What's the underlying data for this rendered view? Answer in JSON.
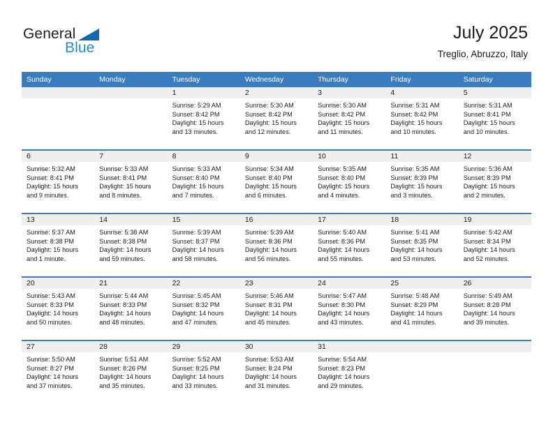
{
  "logo": {
    "word1": "General",
    "word2": "Blue",
    "triangle_color": "#1268b3",
    "word1_color": "#231f20",
    "word2_color": "#1b8fd4"
  },
  "header": {
    "title": "July 2025",
    "subtitle": "Treglio, Abruzzo, Italy"
  },
  "theme": {
    "header_blue": "#3a7cc0",
    "daynum_band": "#efefef",
    "text": "#1a1a1a"
  },
  "weekday_headers": [
    "Sunday",
    "Monday",
    "Tuesday",
    "Wednesday",
    "Thursday",
    "Friday",
    "Saturday"
  ],
  "labels": {
    "sunrise": "Sunrise:",
    "sunset": "Sunset:",
    "daylight": "Daylight:"
  },
  "weeks": [
    [
      {
        "day": "",
        "empty": true
      },
      {
        "day": "",
        "empty": true
      },
      {
        "day": "1",
        "sunrise": "Sunrise: 5:29 AM",
        "sunset": "Sunset: 8:42 PM",
        "daylight": "Daylight: 15 hours and 13 minutes."
      },
      {
        "day": "2",
        "sunrise": "Sunrise: 5:30 AM",
        "sunset": "Sunset: 8:42 PM",
        "daylight": "Daylight: 15 hours and 12 minutes."
      },
      {
        "day": "3",
        "sunrise": "Sunrise: 5:30 AM",
        "sunset": "Sunset: 8:42 PM",
        "daylight": "Daylight: 15 hours and 11 minutes."
      },
      {
        "day": "4",
        "sunrise": "Sunrise: 5:31 AM",
        "sunset": "Sunset: 8:42 PM",
        "daylight": "Daylight: 15 hours and 10 minutes."
      },
      {
        "day": "5",
        "sunrise": "Sunrise: 5:31 AM",
        "sunset": "Sunset: 8:41 PM",
        "daylight": "Daylight: 15 hours and 10 minutes."
      }
    ],
    [
      {
        "day": "6",
        "sunrise": "Sunrise: 5:32 AM",
        "sunset": "Sunset: 8:41 PM",
        "daylight": "Daylight: 15 hours and 9 minutes."
      },
      {
        "day": "7",
        "sunrise": "Sunrise: 5:33 AM",
        "sunset": "Sunset: 8:41 PM",
        "daylight": "Daylight: 15 hours and 8 minutes."
      },
      {
        "day": "8",
        "sunrise": "Sunrise: 5:33 AM",
        "sunset": "Sunset: 8:40 PM",
        "daylight": "Daylight: 15 hours and 7 minutes."
      },
      {
        "day": "9",
        "sunrise": "Sunrise: 5:34 AM",
        "sunset": "Sunset: 8:40 PM",
        "daylight": "Daylight: 15 hours and 6 minutes."
      },
      {
        "day": "10",
        "sunrise": "Sunrise: 5:35 AM",
        "sunset": "Sunset: 8:40 PM",
        "daylight": "Daylight: 15 hours and 4 minutes."
      },
      {
        "day": "11",
        "sunrise": "Sunrise: 5:35 AM",
        "sunset": "Sunset: 8:39 PM",
        "daylight": "Daylight: 15 hours and 3 minutes."
      },
      {
        "day": "12",
        "sunrise": "Sunrise: 5:36 AM",
        "sunset": "Sunset: 8:39 PM",
        "daylight": "Daylight: 15 hours and 2 minutes."
      }
    ],
    [
      {
        "day": "13",
        "sunrise": "Sunrise: 5:37 AM",
        "sunset": "Sunset: 8:38 PM",
        "daylight": "Daylight: 15 hours and 1 minute."
      },
      {
        "day": "14",
        "sunrise": "Sunrise: 5:38 AM",
        "sunset": "Sunset: 8:38 PM",
        "daylight": "Daylight: 14 hours and 59 minutes."
      },
      {
        "day": "15",
        "sunrise": "Sunrise: 5:39 AM",
        "sunset": "Sunset: 8:37 PM",
        "daylight": "Daylight: 14 hours and 58 minutes."
      },
      {
        "day": "16",
        "sunrise": "Sunrise: 5:39 AM",
        "sunset": "Sunset: 8:36 PM",
        "daylight": "Daylight: 14 hours and 56 minutes."
      },
      {
        "day": "17",
        "sunrise": "Sunrise: 5:40 AM",
        "sunset": "Sunset: 8:36 PM",
        "daylight": "Daylight: 14 hours and 55 minutes."
      },
      {
        "day": "18",
        "sunrise": "Sunrise: 5:41 AM",
        "sunset": "Sunset: 8:35 PM",
        "daylight": "Daylight: 14 hours and 53 minutes."
      },
      {
        "day": "19",
        "sunrise": "Sunrise: 5:42 AM",
        "sunset": "Sunset: 8:34 PM",
        "daylight": "Daylight: 14 hours and 52 minutes."
      }
    ],
    [
      {
        "day": "20",
        "sunrise": "Sunrise: 5:43 AM",
        "sunset": "Sunset: 8:33 PM",
        "daylight": "Daylight: 14 hours and 50 minutes."
      },
      {
        "day": "21",
        "sunrise": "Sunrise: 5:44 AM",
        "sunset": "Sunset: 8:33 PM",
        "daylight": "Daylight: 14 hours and 48 minutes."
      },
      {
        "day": "22",
        "sunrise": "Sunrise: 5:45 AM",
        "sunset": "Sunset: 8:32 PM",
        "daylight": "Daylight: 14 hours and 47 minutes."
      },
      {
        "day": "23",
        "sunrise": "Sunrise: 5:46 AM",
        "sunset": "Sunset: 8:31 PM",
        "daylight": "Daylight: 14 hours and 45 minutes."
      },
      {
        "day": "24",
        "sunrise": "Sunrise: 5:47 AM",
        "sunset": "Sunset: 8:30 PM",
        "daylight": "Daylight: 14 hours and 43 minutes."
      },
      {
        "day": "25",
        "sunrise": "Sunrise: 5:48 AM",
        "sunset": "Sunset: 8:29 PM",
        "daylight": "Daylight: 14 hours and 41 minutes."
      },
      {
        "day": "26",
        "sunrise": "Sunrise: 5:49 AM",
        "sunset": "Sunset: 8:28 PM",
        "daylight": "Daylight: 14 hours and 39 minutes."
      }
    ],
    [
      {
        "day": "27",
        "sunrise": "Sunrise: 5:50 AM",
        "sunset": "Sunset: 8:27 PM",
        "daylight": "Daylight: 14 hours and 37 minutes."
      },
      {
        "day": "28",
        "sunrise": "Sunrise: 5:51 AM",
        "sunset": "Sunset: 8:26 PM",
        "daylight": "Daylight: 14 hours and 35 minutes."
      },
      {
        "day": "29",
        "sunrise": "Sunrise: 5:52 AM",
        "sunset": "Sunset: 8:25 PM",
        "daylight": "Daylight: 14 hours and 33 minutes."
      },
      {
        "day": "30",
        "sunrise": "Sunrise: 5:53 AM",
        "sunset": "Sunset: 8:24 PM",
        "daylight": "Daylight: 14 hours and 31 minutes."
      },
      {
        "day": "31",
        "sunrise": "Sunrise: 5:54 AM",
        "sunset": "Sunset: 8:23 PM",
        "daylight": "Daylight: 14 hours and 29 minutes."
      },
      {
        "day": "",
        "empty": true
      },
      {
        "day": "",
        "empty": true
      }
    ]
  ]
}
